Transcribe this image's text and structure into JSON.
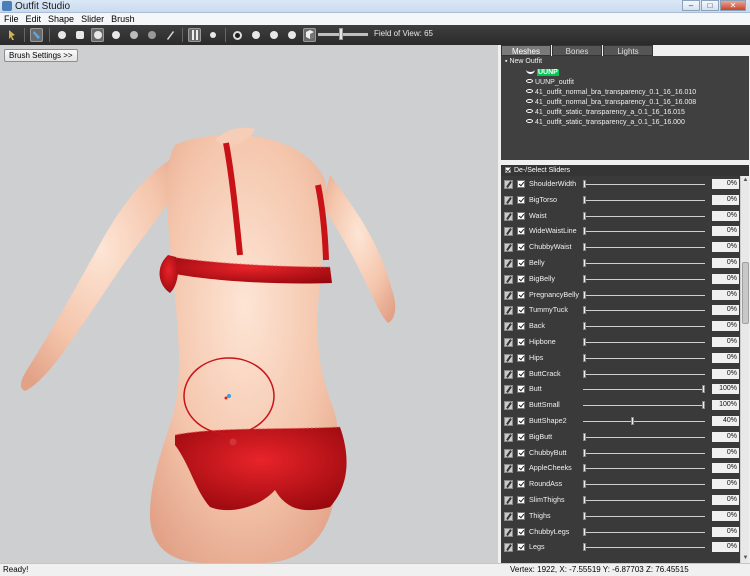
{
  "window": {
    "title": "Outfit Studio",
    "buttons": [
      "–",
      "□",
      "✕"
    ]
  },
  "menu": [
    "File",
    "Edit",
    "Shape",
    "Slider",
    "Brush"
  ],
  "toolbar": {
    "fov_label": "Field of View: 65",
    "fov_value": 65
  },
  "viewport": {
    "brush_settings_label": "Brush Settings >>"
  },
  "tabs": [
    {
      "label": "Meshes",
      "active": true
    },
    {
      "label": "Bones",
      "active": false
    },
    {
      "label": "Lights",
      "active": false
    }
  ],
  "meshes": {
    "root": "New Outfit",
    "reference": "UUNP",
    "items": [
      "UUNP_outfit",
      "41_outfit_normal_bra_transparency_0.1_16_16.010",
      "41_outfit_normal_bra_transparency_0.1_16_16.008",
      "41_outfit_static_transparency_a_0.1_16_16.015",
      "41_outfit_static_transparency_a_0.1_16_16.000"
    ]
  },
  "sliders_header": "De-/Select Sliders",
  "sliders": [
    {
      "name": "ShoulderWidth",
      "value": 0,
      "label": "0%"
    },
    {
      "name": "BigTorso",
      "value": 0,
      "label": "0%"
    },
    {
      "name": "Waist",
      "value": 0,
      "label": "0%"
    },
    {
      "name": "WideWaistLine",
      "value": 0,
      "label": "0%"
    },
    {
      "name": "ChubbyWaist",
      "value": 0,
      "label": "0%"
    },
    {
      "name": "Belly",
      "value": 0,
      "label": "0%"
    },
    {
      "name": "BigBelly",
      "value": 0,
      "label": "0%"
    },
    {
      "name": "PregnancyBelly",
      "value": 0,
      "label": "0%"
    },
    {
      "name": "TummyTuck",
      "value": 0,
      "label": "0%"
    },
    {
      "name": "Back",
      "value": 0,
      "label": "0%"
    },
    {
      "name": "Hipbone",
      "value": 0,
      "label": "0%"
    },
    {
      "name": "Hips",
      "value": 0,
      "label": "0%"
    },
    {
      "name": "ButtCrack",
      "value": 0,
      "label": "0%"
    },
    {
      "name": "Butt",
      "value": 100,
      "label": "100%"
    },
    {
      "name": "ButtSmall",
      "value": 100,
      "label": "100%"
    },
    {
      "name": "ButtShape2",
      "value": 40,
      "label": "40%"
    },
    {
      "name": "BigButt",
      "value": 0,
      "label": "0%"
    },
    {
      "name": "ChubbyButt",
      "value": 0,
      "label": "0%"
    },
    {
      "name": "AppleCheeks",
      "value": 0,
      "label": "0%"
    },
    {
      "name": "RoundAss",
      "value": 0,
      "label": "0%"
    },
    {
      "name": "SlimThighs",
      "value": 0,
      "label": "0%"
    },
    {
      "name": "Thighs",
      "value": 0,
      "label": "0%"
    },
    {
      "name": "ChubbyLegs",
      "value": 0,
      "label": "0%"
    },
    {
      "name": "Legs",
      "value": 0,
      "label": "0%"
    }
  ],
  "status": {
    "left": "Ready!",
    "right": "Vertex: 1922, X: -7.55519 Y: -6.87703 Z: 76.45515"
  }
}
